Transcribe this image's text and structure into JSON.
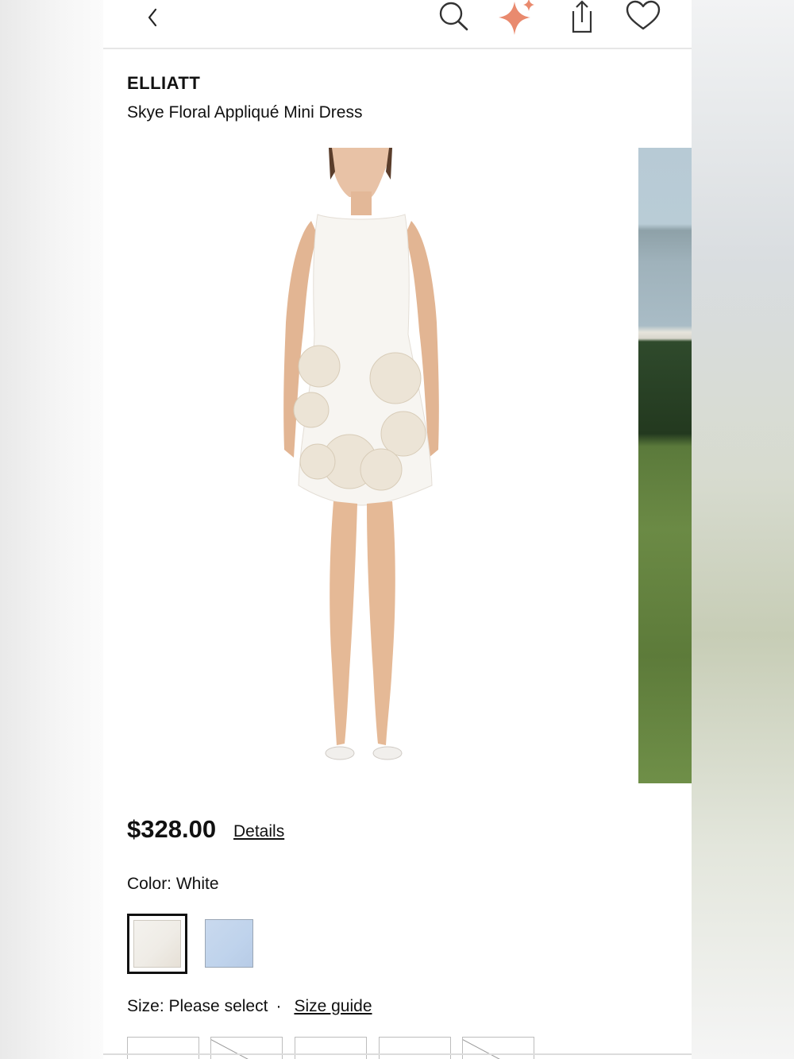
{
  "header": {
    "back_icon": "chevron-left-icon",
    "search_icon": "search-icon",
    "sparkle_icon": "sparkle-icon",
    "share_icon": "share-icon",
    "wishlist_icon": "heart-icon"
  },
  "product": {
    "brand": "ELLIATT",
    "name": "Skye Floral Appliqué Mini Dress",
    "price": "$328.00",
    "details_label": "Details",
    "color_label": "Color: White",
    "colors": [
      {
        "name": "White",
        "selected": true,
        "swatch": "#f1eee8"
      },
      {
        "name": "Blue",
        "selected": false,
        "swatch": "#c3d5ed"
      }
    ],
    "size_label": "Size: Please select",
    "size_separator": "·",
    "size_guide_label": "Size guide",
    "sizes": [
      {
        "available": true
      },
      {
        "available": false
      },
      {
        "available": true
      },
      {
        "available": true
      },
      {
        "available": false
      }
    ]
  },
  "colors": {
    "sparkle_accent": "#e98a6e",
    "text": "#111111"
  }
}
